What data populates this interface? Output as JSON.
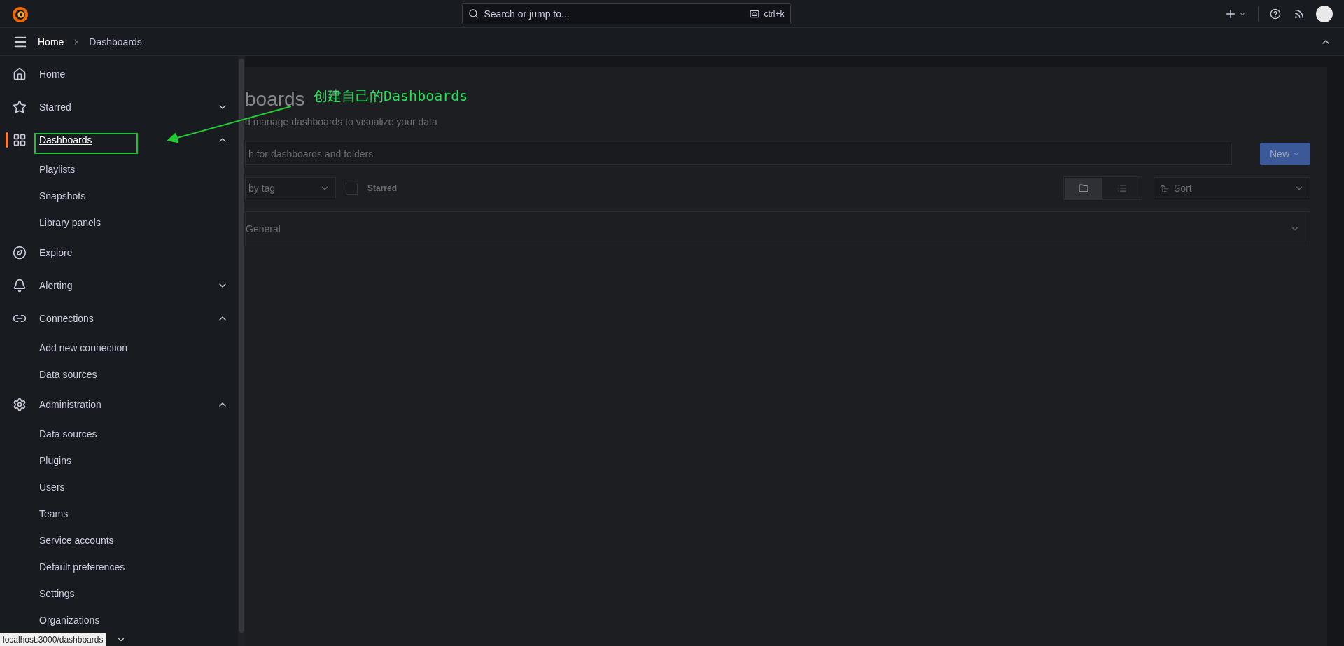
{
  "topbar": {
    "search": {
      "placeholder": "Search or jump to..."
    },
    "shortcut": "ctrl+k"
  },
  "breadcrumbs": [
    "Home",
    "Dashboards"
  ],
  "sidebar": {
    "items": [
      {
        "label": "Home",
        "selected": false
      },
      {
        "label": "Starred",
        "selected": false,
        "expanded": false
      },
      {
        "label": "Dashboards",
        "selected": true,
        "expanded": true,
        "children": [
          {
            "label": "Playlists",
            "selected": false
          },
          {
            "label": "Snapshots",
            "selected": false
          },
          {
            "label": "Library panels",
            "selected": false
          }
        ]
      },
      {
        "label": "Explore",
        "selected": false
      },
      {
        "label": "Alerting",
        "selected": false,
        "expanded": false
      },
      {
        "label": "Connections",
        "selected": false,
        "expanded": true,
        "children": [
          {
            "label": "Add new connection",
            "selected": false
          },
          {
            "label": "Data sources",
            "selected": false
          }
        ]
      },
      {
        "label": "Administration",
        "selected": false,
        "expanded": true,
        "children": [
          {
            "label": "Data sources",
            "selected": false
          },
          {
            "label": "Plugins",
            "selected": false
          },
          {
            "label": "Users",
            "selected": false
          },
          {
            "label": "Teams",
            "selected": false
          },
          {
            "label": "Service accounts",
            "selected": false
          },
          {
            "label": "Default preferences",
            "selected": false
          },
          {
            "label": "Settings",
            "selected": false
          },
          {
            "label": "Organizations",
            "selected": false
          }
        ]
      }
    ]
  },
  "main": {
    "title": "boards",
    "subtitle": "d manage dashboards to visualize your data",
    "search": {
      "placeholder": "h for dashboards and folders"
    },
    "new_button": "New",
    "tag_filter": "by tag",
    "starred_filter": {
      "label": "Starred",
      "checked": false
    },
    "view_modes": [
      {
        "kind": "folder",
        "selected": true
      },
      {
        "kind": "list",
        "selected": false
      }
    ],
    "sort": "Sort",
    "folders": [
      {
        "name": "General",
        "expanded": false
      }
    ]
  },
  "annotation": {
    "text": "创建自己的Dashboards"
  },
  "status_link": "localhost:3000/dashboards"
}
